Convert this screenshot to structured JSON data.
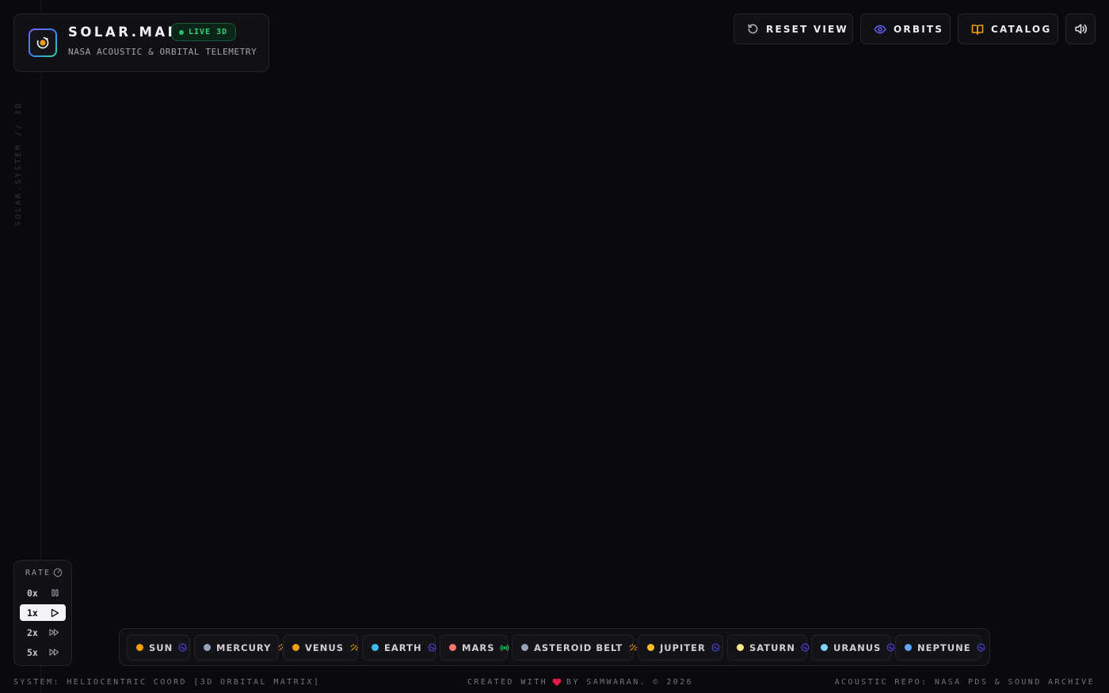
{
  "sidebar": {
    "vertical_label": "SOLAR.SYSTEM // 3D"
  },
  "brand": {
    "title": "SOLAR.MAP",
    "badge": "LIVE 3D",
    "subtitle": "NASA ACOUSTIC & ORBITAL TELEMETRY"
  },
  "toolbar": {
    "reset_label": "RESET VIEW",
    "orbits_label": "ORBITS",
    "catalog_label": "CATALOG",
    "sound_icon": "speaker-icon"
  },
  "rate": {
    "label": "RATE",
    "options": [
      {
        "label": "0x",
        "icon": "pause-icon",
        "active": false
      },
      {
        "label": "1x",
        "icon": "play-icon",
        "active": true
      },
      {
        "label": "2x",
        "icon": "fast-forward-icon",
        "active": false
      },
      {
        "label": "5x",
        "icon": "fast-forward-icon",
        "active": false
      }
    ]
  },
  "bodies": [
    {
      "name": "SUN",
      "color": "#f59e0b",
      "icon": "orbit-wave-icon"
    },
    {
      "name": "MERCURY",
      "color": "#94a3b8",
      "icon": "sparkle-icon"
    },
    {
      "name": "VENUS",
      "color": "#f59e0b",
      "icon": "sparkle-icon"
    },
    {
      "name": "EARTH",
      "color": "#38bdf8",
      "icon": "orbit-wave-icon"
    },
    {
      "name": "MARS",
      "color": "#f87171",
      "icon": "radio-signal-icon"
    },
    {
      "name": "ASTEROID BELT",
      "color": "#94a3b8",
      "icon": "sparkle-icon"
    },
    {
      "name": "JUPITER",
      "color": "#fbbf24",
      "icon": "orbit-wave-icon"
    },
    {
      "name": "SATURN",
      "color": "#fde68a",
      "icon": "orbit-wave-icon"
    },
    {
      "name": "URANUS",
      "color": "#7dd3fc",
      "icon": "orbit-wave-icon"
    },
    {
      "name": "NEPTUNE",
      "color": "#60a5fa",
      "icon": "orbit-wave-icon"
    }
  ],
  "footer": {
    "left": "SYSTEM: HELIOCENTRIC COORD [3D ORBITAL MATRIX]",
    "center_pre": "CREATED WITH",
    "center_post": "BY SAMWARAN. © 2026",
    "right": "ACOUSTIC REPO: NASA PDS & SOUND ARCHIVE"
  },
  "colors": {
    "background": "#0a0a0d",
    "live_green": "#22c55e",
    "accent_blue": "#6366f1",
    "accent_amber": "#f59e0b",
    "heart_red": "#e11d48"
  }
}
